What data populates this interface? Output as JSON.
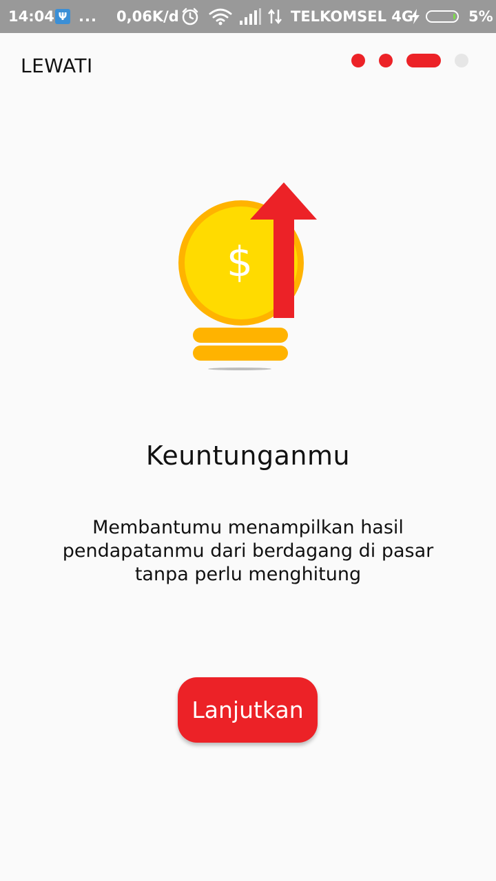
{
  "status_bar": {
    "time": "14:04",
    "usb_glyph": "Ψ",
    "more": "...",
    "speed": "0,06K/d",
    "alarm_icon": "alarm-icon",
    "wifi_icon": "wifi-icon",
    "signal_icon": "signal-icon",
    "data_icon": "data-transfer-icon",
    "carrier": "TELKOMSEL 4G",
    "charging_icon": "charging-icon",
    "battery_level": 0.05,
    "battery_percent": "5%"
  },
  "header": {
    "skip_label": "LEWATI",
    "pages_total": 4,
    "current_page": 3
  },
  "colors": {
    "accent": "#ec2227",
    "dot_active": "#ec2227",
    "dot_inactive": "#e6e6e6",
    "coin": "#ffdb00",
    "coin_rim": "#ffb300",
    "background": "#fafafa"
  },
  "illustration": {
    "icon": "coin-growth-icon",
    "symbol": "$"
  },
  "content": {
    "title": "Keuntunganmu",
    "description": "Membantumu menampilkan hasil pendapatanmu dari berdagang di pasar tanpa perlu menghitung"
  },
  "actions": {
    "continue_label": "Lanjutkan"
  }
}
